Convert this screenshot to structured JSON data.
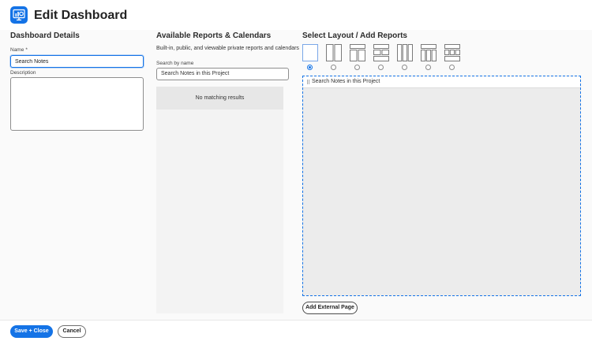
{
  "header": {
    "title": "Edit Dashboard",
    "app_icon": "dashboard-icon"
  },
  "details": {
    "heading": "Dashboard Details",
    "name_label": "Name",
    "required_mark": "*",
    "name_value": "Search Notes",
    "description_label": "Description",
    "description_value": ""
  },
  "reports": {
    "heading": "Available Reports & Calendars",
    "subtitle": "Built-in, public, and viewable private reports and calendars",
    "search_label": "Search by name",
    "search_value": "Search Notes in this Project",
    "no_results": "No matching results"
  },
  "layout": {
    "heading": "Select Layout / Add Reports",
    "options": [
      "single",
      "two-column",
      "top-two-column",
      "two-row-split",
      "three-column",
      "top-three-column",
      "grid"
    ],
    "selected_index": 0,
    "report_items": [
      {
        "name": "Search Notes in this Project"
      }
    ],
    "add_external_label": "Add External Page"
  },
  "footer": {
    "save_label": "Save + Close",
    "cancel_label": "Cancel"
  },
  "colors": {
    "accent": "#1473e6"
  }
}
